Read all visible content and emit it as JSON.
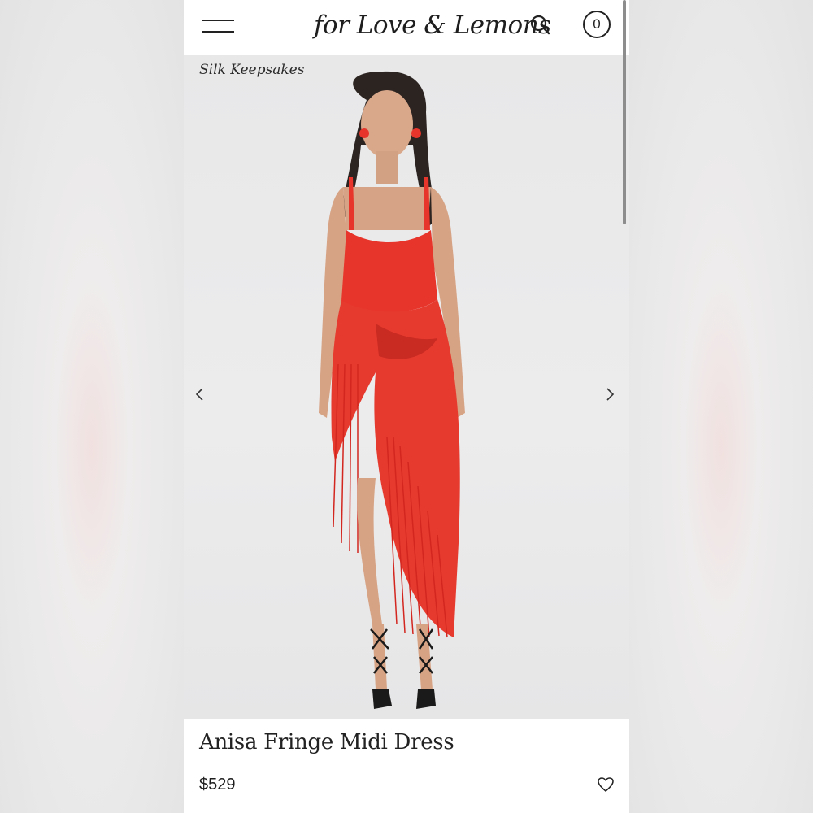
{
  "header": {
    "logo_text": "for Love & Lemons",
    "cart_count": "0",
    "menu_icon": "hamburger-menu-icon",
    "search_icon": "search-icon"
  },
  "hero": {
    "collection_label": "Silk Keepsakes",
    "prev_icon": "chevron-left-icon",
    "next_icon": "chevron-right-icon"
  },
  "product": {
    "title": "Anisa Fringe Midi Dress",
    "price": "$529",
    "wishlist_icon": "heart-icon"
  },
  "colors": {
    "dress": "#e8352b",
    "background": "#ebebec",
    "text": "#222222"
  }
}
